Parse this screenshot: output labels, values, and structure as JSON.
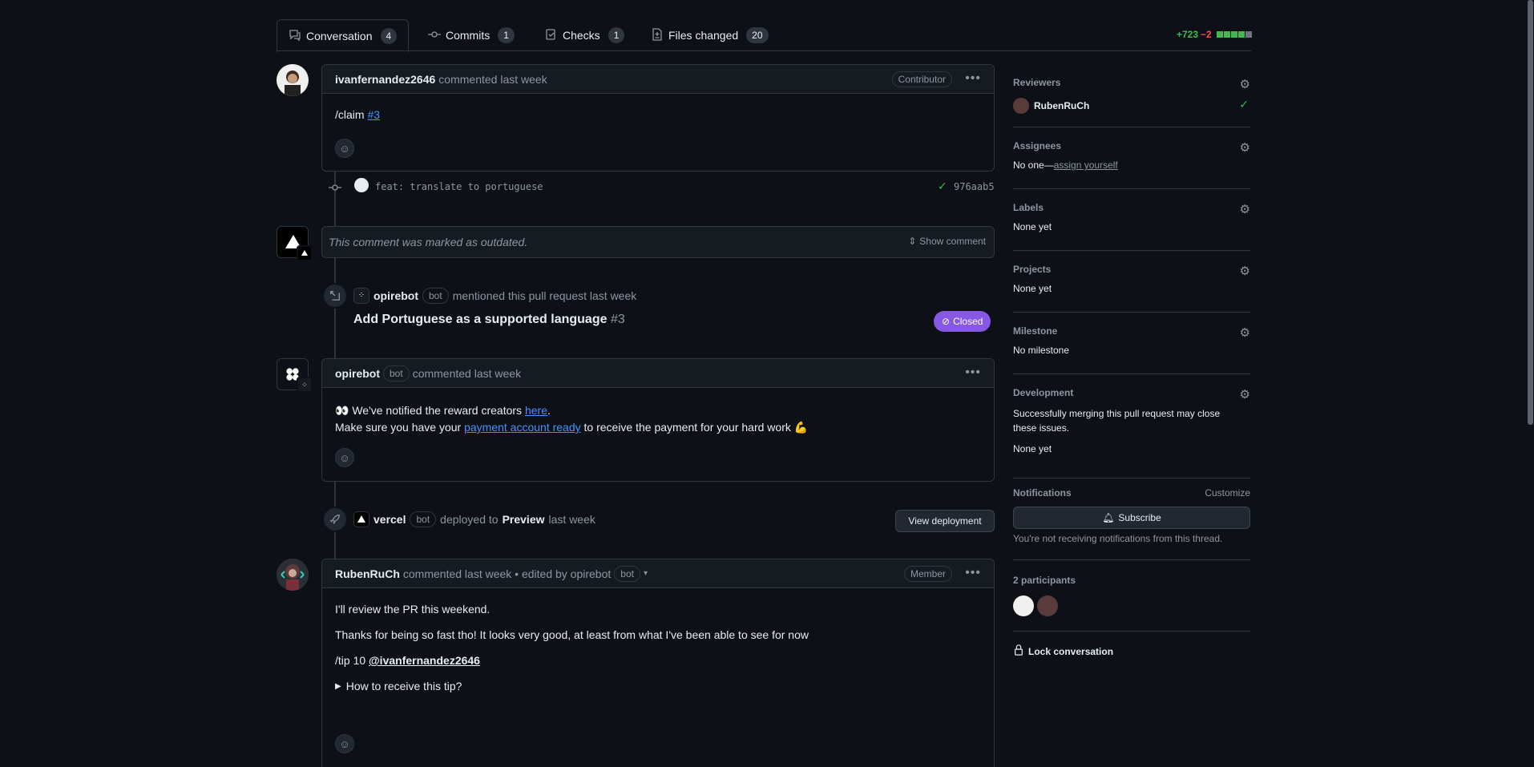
{
  "tabs": [
    {
      "label": "Conversation",
      "count": "4"
    },
    {
      "label": "Commits",
      "count": "1"
    },
    {
      "label": "Checks",
      "count": "1"
    },
    {
      "label": "Files changed",
      "count": "20"
    }
  ],
  "diffstat": {
    "additions": "+723",
    "deletions": "−2"
  },
  "comment1": {
    "author": "ivanfernandez2646",
    "meta": "commented last week",
    "badge": "Contributor",
    "body_prefix": "/claim ",
    "body_link": "#3"
  },
  "commit": {
    "message": "feat: translate to portuguese",
    "sha": "976aab5"
  },
  "outdated": {
    "text": "This comment was marked as outdated.",
    "show": "Show comment"
  },
  "mention": {
    "author": "opirebot",
    "bot": "bot",
    "meta": "mentioned this pull request last week",
    "issue_title": "Add Portuguese as a supported language",
    "issue_num": "#3",
    "state": "Closed"
  },
  "comment2": {
    "author": "opirebot",
    "bot": "bot",
    "meta": "commented last week",
    "line1_prefix": "👀 We've notified the reward creators ",
    "line1_link": "here",
    "line1_suffix": ".",
    "line2_prefix": "Make sure you have your ",
    "line2_link": "payment account ready",
    "line2_suffix": " to receive the payment for your hard work 💪"
  },
  "deploy": {
    "author": "vercel",
    "bot": "bot",
    "meta_pre": "deployed to",
    "env": "Preview",
    "meta_post": "last week",
    "button": "View deployment"
  },
  "comment3": {
    "author": "RubenRuCh",
    "meta": "commented last week • edited by opirebot",
    "bot": "bot",
    "badge": "Member",
    "p1": "I'll review the PR this weekend.",
    "p2": "Thanks for being so fast tho! It looks very good, at least from what I've been able to see for now",
    "tip_prefix": "/tip 10 ",
    "tip_user": "@ivanfernandez2646",
    "details": "How to receive this tip?"
  },
  "sidebar": {
    "reviewers_title": "Reviewers",
    "reviewer": "RubenRuCh",
    "assignees_title": "Assignees",
    "assignees_none": "No one—",
    "assign_link": "assign yourself",
    "labels_title": "Labels",
    "labels_value": "None yet",
    "projects_title": "Projects",
    "projects_value": "None yet",
    "milestone_title": "Milestone",
    "milestone_value": "No milestone",
    "development_title": "Development",
    "development_text": "Successfully merging this pull request may close these issues.",
    "development_value": "None yet",
    "notifications_title": "Notifications",
    "customize": "Customize",
    "subscribe": "Subscribe",
    "notif_text": "You're not receiving notifications from this thread.",
    "participants_title": "2 participants",
    "lock": "Lock conversation"
  },
  "colors": {
    "accent": "#4493f8",
    "success": "#3fb950",
    "danger": "#f85149",
    "closed": "#8957e5"
  }
}
